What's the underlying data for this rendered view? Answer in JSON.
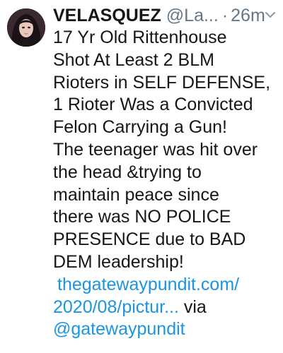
{
  "tweet": {
    "display_name": "VELASQUEZ",
    "handle": "@La...",
    "separator": "·",
    "time": "26m",
    "body_lines": [
      "17 Yr Old Rittenhouse",
      "Shot At Least 2 BLM",
      "Rioters in SELF DEFENSE,",
      "1 Rioter Was a Convicted",
      "Felon Carrying a Gun!",
      "The teenager was hit over",
      "the head &trying to",
      "maintain peace since",
      "there was NO POLICE",
      "PRESENCE due to BAD",
      "DEM leadership!"
    ],
    "link_line_1": "thegatewaypundit.com/",
    "link_line_2": "2020/08/pictur...",
    "via": " via",
    "mention_partial": "@gatewaypundit"
  },
  "icons": {
    "avatar": "profile-avatar",
    "menu": "chevron-down-icon"
  },
  "colors": {
    "text": "#14171a",
    "secondary": "#657786",
    "link": "#1b95e0",
    "background": "#ffffff"
  }
}
